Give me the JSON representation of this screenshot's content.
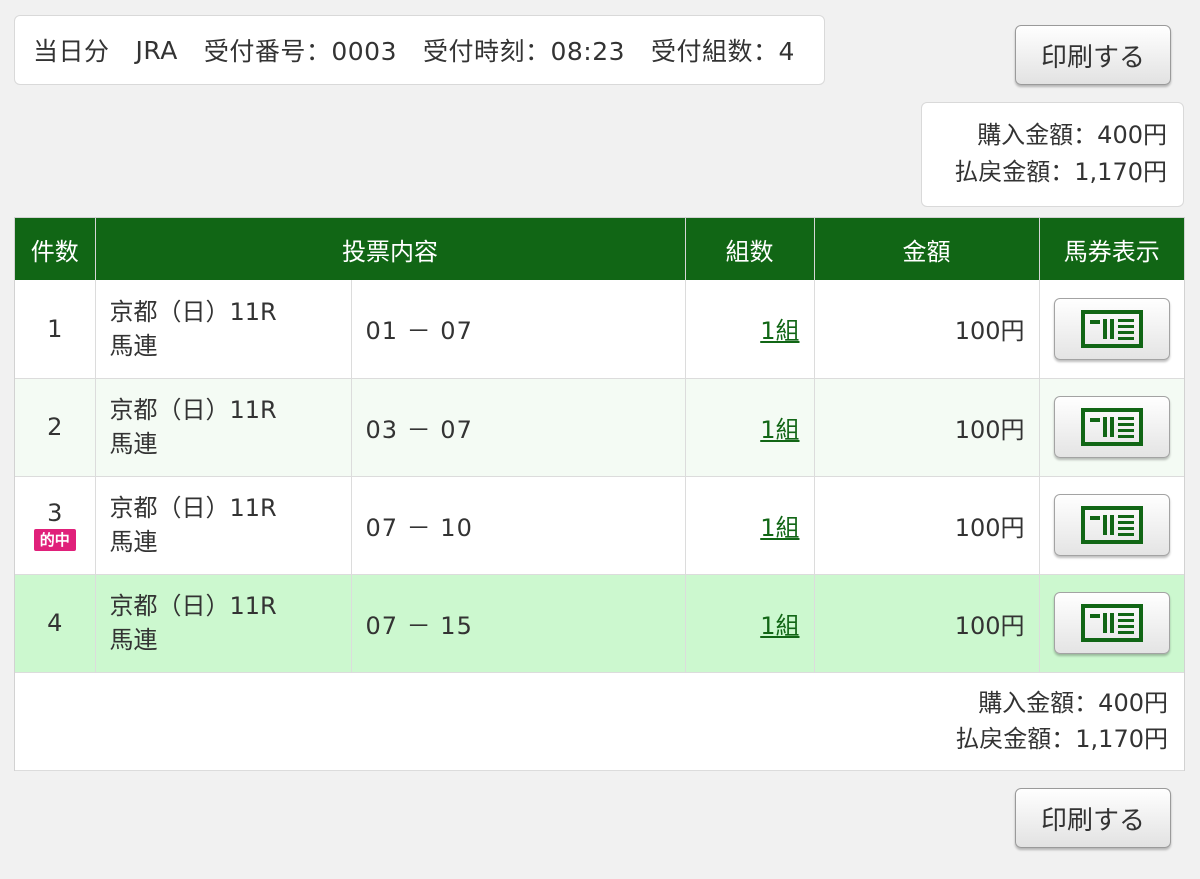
{
  "info": {
    "day": "当日分",
    "org": "JRA",
    "receipt_no": "受付番号：0003",
    "receipt_time": "受付時刻：08:23",
    "receipt_count": "受付組数：4"
  },
  "buttons": {
    "print": "印刷する"
  },
  "summary": {
    "purchase": "購入金額：400円",
    "payout": "払戻金額：1,170円"
  },
  "table": {
    "headers": {
      "count": "件数",
      "content": "投票内容",
      "kumi": "組数",
      "amount": "金額",
      "ticket": "馬券表示"
    },
    "rows": [
      {
        "no": "1",
        "race": "京都（日）11R",
        "bet_type": "馬連",
        "combo": "01 － 07",
        "kumi": "1組",
        "amount": "100円",
        "hit": ""
      },
      {
        "no": "2",
        "race": "京都（日）11R",
        "bet_type": "馬連",
        "combo": "03 － 07",
        "kumi": "1組",
        "amount": "100円",
        "hit": ""
      },
      {
        "no": "3",
        "race": "京都（日）11R",
        "bet_type": "馬連",
        "combo": "07 － 10",
        "kumi": "1組",
        "amount": "100円",
        "hit": "的中"
      },
      {
        "no": "4",
        "race": "京都（日）11R",
        "bet_type": "馬連",
        "combo": "07 － 15",
        "kumi": "1組",
        "amount": "100円",
        "hit": ""
      }
    ]
  },
  "colors": {
    "header_green": "#116615",
    "hit_pink": "#e0207a",
    "highlight_row": "#ccf8cf"
  },
  "icons": {
    "ticket": "ticket-icon"
  }
}
